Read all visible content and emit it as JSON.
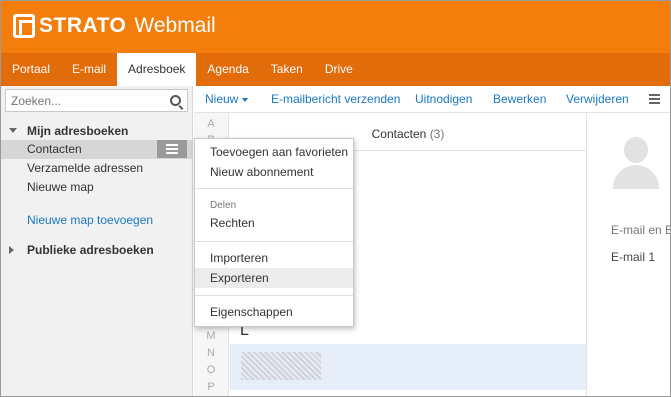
{
  "brand": {
    "name": "STRATO",
    "product": "Webmail"
  },
  "nav": {
    "tabs": [
      {
        "label": "Portaal"
      },
      {
        "label": "E-mail"
      },
      {
        "label": "Adresboek"
      },
      {
        "label": "Agenda"
      },
      {
        "label": "Taken"
      },
      {
        "label": "Drive"
      }
    ],
    "active": "Adresboek"
  },
  "search": {
    "placeholder": "Zoeken..."
  },
  "sidebar": {
    "my_books": "Mijn adresboeken",
    "items": [
      {
        "label": "Contacten"
      },
      {
        "label": "Verzamelde adressen"
      },
      {
        "label": "Nieuwe map"
      }
    ],
    "new_folder": "Nieuwe map toevoegen",
    "public_books": "Publieke adresboeken"
  },
  "toolbar": {
    "new": "Nieuw",
    "send": "E-mailbericht verzenden",
    "invite": "Uitnodigen",
    "edit": "Bewerken",
    "delete": "Verwijderen"
  },
  "alphabet": [
    "A",
    "B",
    "M",
    "N",
    "O",
    "P"
  ],
  "list": {
    "title": "Contacten",
    "count": "(3)",
    "section_letter": "L"
  },
  "detail": {
    "label": "E-mail en B",
    "value": "E-mail 1"
  },
  "context_menu": {
    "add_favorites": "Toevoegen aan favorieten",
    "new_subscription": "Nieuw abonnement",
    "share_section": "Delen",
    "permissions": "Rechten",
    "import": "Importeren",
    "export": "Exporteren",
    "properties": "Eigenschappen"
  },
  "colors": {
    "header": "#f37e0c",
    "nav": "#e26b0a",
    "link": "#1a78c2"
  }
}
